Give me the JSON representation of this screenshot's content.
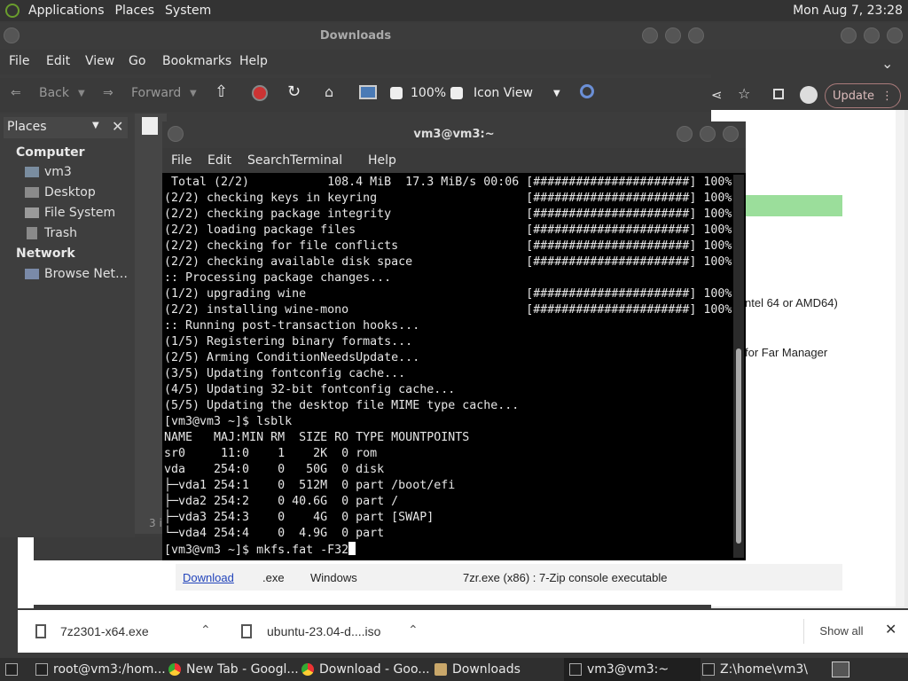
{
  "top_panel": {
    "menus": [
      "Applications",
      "Places",
      "System"
    ],
    "clock": "Mon Aug  7, 23:28"
  },
  "browser": {
    "update_label": "Update",
    "page_rows": [
      {
        "text": "ntel 64 or AMD64)"
      },
      {
        "text": "for Far Manager"
      }
    ],
    "table_row": {
      "link": "Download",
      "ext": ".exe",
      "os": "Windows",
      "desc": "7zr.exe (x86) : 7-Zip console executable"
    }
  },
  "file_manager": {
    "title": "Downloads",
    "menu": [
      "File",
      "Edit",
      "View",
      "Go",
      "Bookmarks",
      "Help"
    ],
    "toolbar": {
      "back": "Back",
      "forward": "Forward",
      "zoom": "100%",
      "view_mode": "Icon View"
    },
    "places_header": "Places",
    "sections": [
      {
        "heading": "Computer",
        "items": [
          "vm3",
          "Desktop",
          "File System",
          "Trash"
        ]
      },
      {
        "heading": "Network",
        "items": [
          "Browse Net…"
        ]
      }
    ],
    "status_partial": "3 i"
  },
  "terminal": {
    "title": "vm3@vm3:~",
    "menu": [
      "File",
      "Edit",
      "Search",
      "Terminal",
      "Help"
    ],
    "lines": [
      " Total (2/2)           108.4 MiB  17.3 MiB/s 00:06 [######################] 100%",
      "(2/2) checking keys in keyring                     [######################] 100%",
      "(2/2) checking package integrity                   [######################] 100%",
      "(2/2) loading package files                        [######################] 100%",
      "(2/2) checking for file conflicts                  [######################] 100%",
      "(2/2) checking available disk space                [######################] 100%",
      ":: Processing package changes...",
      "(1/2) upgrading wine                               [######################] 100%",
      "(2/2) installing wine-mono                         [######################] 100%",
      ":: Running post-transaction hooks...",
      "(1/5) Registering binary formats...",
      "(2/5) Arming ConditionNeedsUpdate...",
      "(3/5) Updating fontconfig cache...",
      "(4/5) Updating 32-bit fontconfig cache...",
      "(5/5) Updating the desktop file MIME type cache...",
      "[vm3@vm3 ~]$ lsblk",
      "NAME   MAJ:MIN RM  SIZE RO TYPE MOUNTPOINTS",
      "sr0     11:0    1    2K  0 rom",
      "vda    254:0    0   50G  0 disk",
      "├─vda1 254:1    0  512M  0 part /boot/efi",
      "├─vda2 254:2    0 40.6G  0 part /",
      "├─vda3 254:3    0    4G  0 part [SWAP]",
      "└─vda4 254:4    0  4.9G  0 part",
      "[vm3@vm3 ~]$ mkfs.fat -F32"
    ]
  },
  "downloads_bar": {
    "items": [
      "7z2301-x64.exe",
      "ubuntu-23.04-d....iso"
    ],
    "show_all": "Show all"
  },
  "taskbar": {
    "items": [
      "root@vm3:/hom...",
      "New Tab - Googl...",
      "Download - Goo...",
      "Downloads",
      "vm3@vm3:~",
      "Z:\\home\\vm3\\"
    ]
  }
}
